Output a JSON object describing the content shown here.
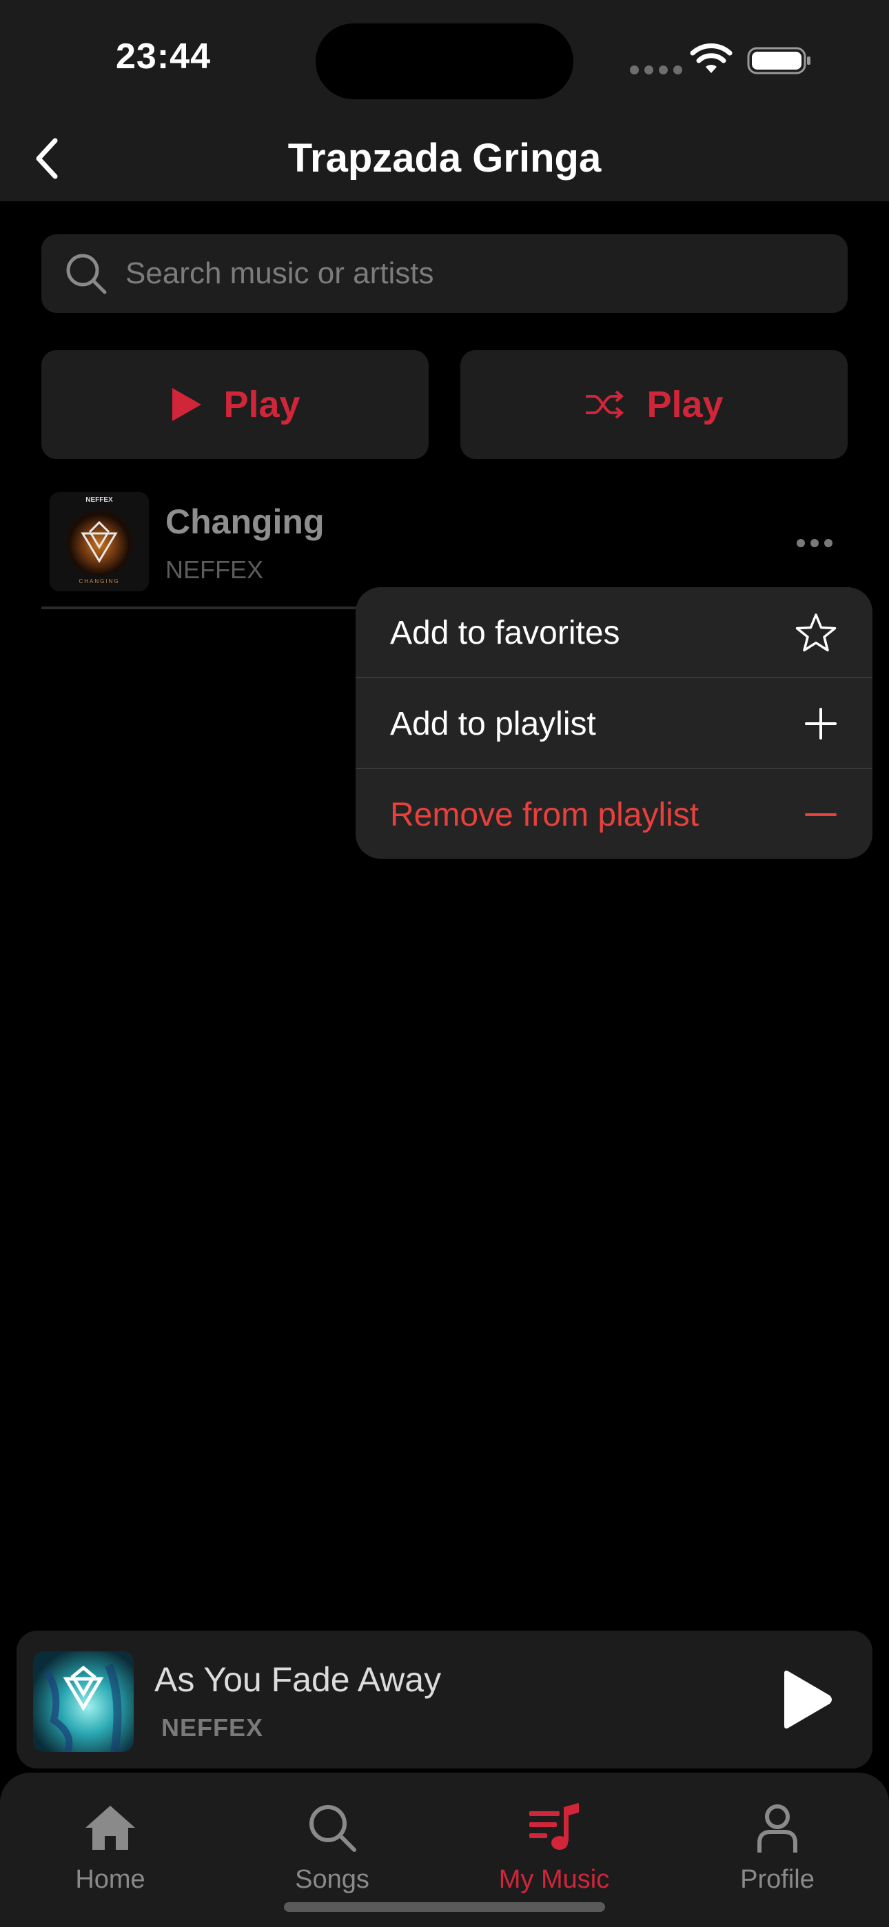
{
  "status_bar": {
    "time": "23:44"
  },
  "header": {
    "title": "Trapzada Gringa"
  },
  "search": {
    "placeholder": "Search music or artists",
    "value": ""
  },
  "actions": {
    "play_label": "Play",
    "shuffle_label": "Play",
    "accent_color": "#d1263a"
  },
  "songs": [
    {
      "title": "Changing",
      "artist": "NEFFEX",
      "art_text_top": "NEFFEX",
      "art_text_bottom": "CHANGING"
    }
  ],
  "context_menu": {
    "items": [
      {
        "label": "Add to favorites",
        "icon": "star-icon"
      },
      {
        "label": "Add to playlist",
        "icon": "plus-icon"
      },
      {
        "label": "Remove from playlist",
        "icon": "minus-icon",
        "destructive": true
      }
    ],
    "destructive_color": "#e8413c"
  },
  "now_playing": {
    "title": "As You Fade Away",
    "artist": "NEFFEX"
  },
  "tabs": [
    {
      "label": "Home",
      "icon": "home-icon"
    },
    {
      "label": "Songs",
      "icon": "search-icon"
    },
    {
      "label": "My Music",
      "icon": "music-list-icon",
      "active": true
    },
    {
      "label": "Profile",
      "icon": "person-icon"
    }
  ]
}
